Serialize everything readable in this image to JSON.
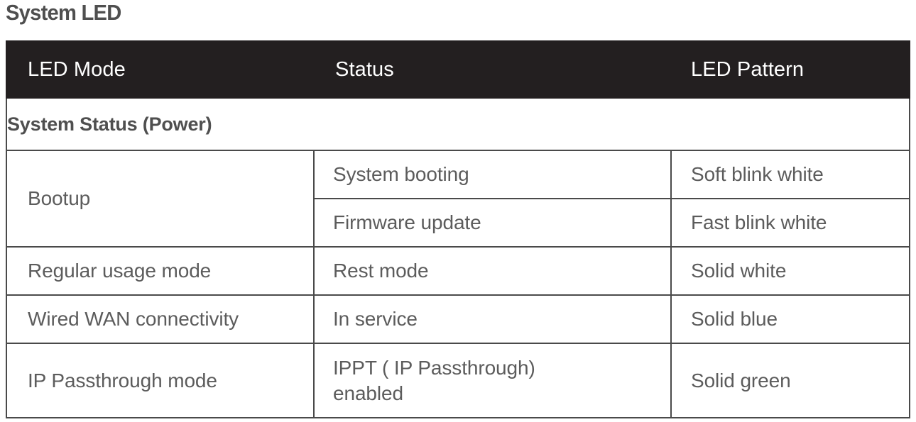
{
  "page": {
    "title": "System LED"
  },
  "table": {
    "headers": {
      "mode": "LED Mode",
      "status": "Status",
      "pattern": "LED Pattern"
    },
    "section_heading": "System Status (Power)",
    "rows": [
      {
        "mode": "Bootup",
        "mode_rowspan": 2,
        "status": "System booting",
        "pattern": "Soft blink white"
      },
      {
        "mode": null,
        "status": "Firmware update",
        "pattern": "Fast blink white"
      },
      {
        "mode": "Regular usage mode",
        "status": "Rest mode",
        "pattern": "Solid white"
      },
      {
        "mode": "Wired WAN connectivity",
        "status": "In service",
        "pattern": "Solid blue"
      },
      {
        "mode": "IP Passthrough mode",
        "status_line1": "IPPT ( IP Passthrough)",
        "status_line2": "enabled",
        "pattern": "Solid green"
      }
    ]
  },
  "colors": {
    "header_background": "#231f20",
    "header_text": "#ffffff",
    "body_text": "#5c5c5c",
    "heading_text": "#4f4f4f",
    "border": "#4a4a4a",
    "page_background": "#ffffff"
  }
}
